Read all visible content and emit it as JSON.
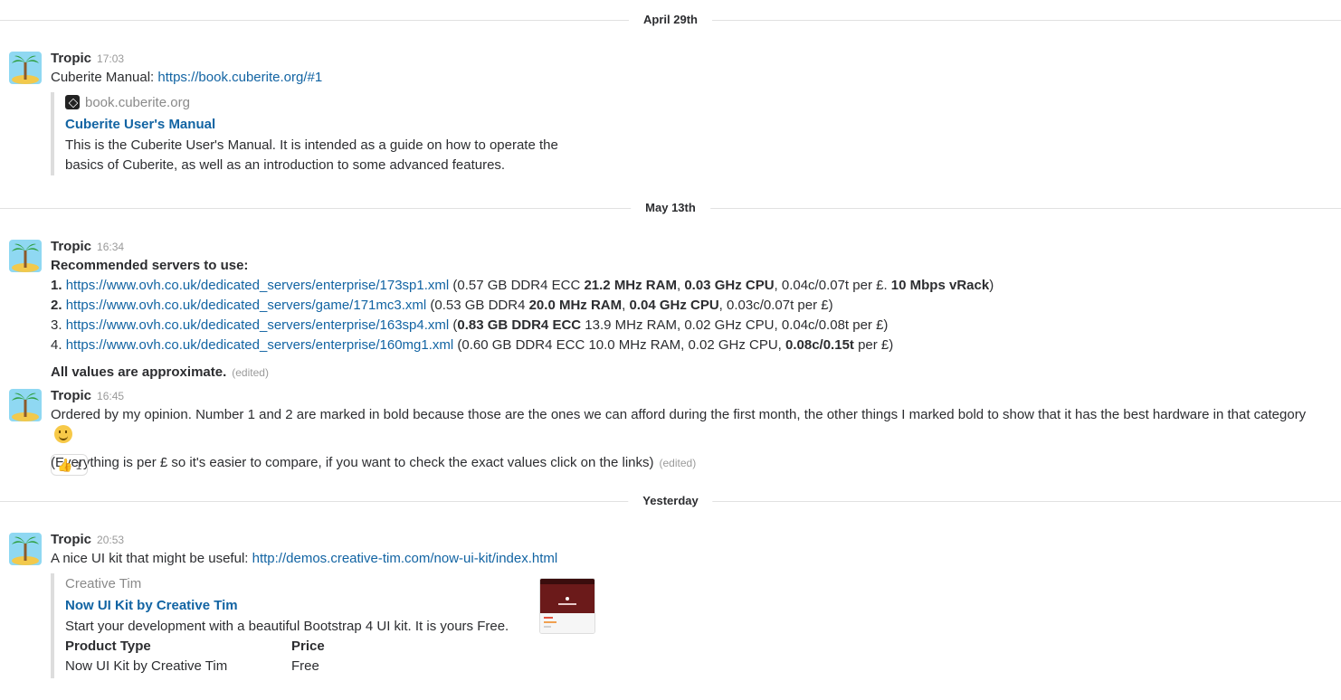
{
  "dividers": [
    "April 29th",
    "May 13th",
    "Yesterday"
  ],
  "messages": {
    "m1": {
      "sender": "Tropic",
      "time": "17:03",
      "prefix": "Cuberite Manual: ",
      "link": "https://book.cuberite.org/#1",
      "attachment": {
        "service": "book.cuberite.org",
        "title": "Cuberite User's Manual",
        "text1": "This is the Cuberite User's Manual. It is intended as a guide on how to operate the",
        "text2": "basics of Cuberite, as well as an introduction to some advanced features."
      }
    },
    "m2": {
      "sender": "Tropic",
      "time": "16:34",
      "heading": "Recommended servers to use:",
      "items": [
        {
          "num": "1.",
          "url": "https://www.ovh.co.uk/dedicated_servers/enterprise/173sp1.xml",
          "a": " (0.57 GB DDR4 ECC ",
          "b1": "21.2 MHz RAM",
          "c": ", ",
          "b2": "0.03 GHz CPU",
          "d": ", 0.04c/0.07t per £. ",
          "b3": "10 Mbps vRack",
          "e": ")"
        },
        {
          "num": "2.",
          "url": "https://www.ovh.co.uk/dedicated_servers/game/171mc3.xml",
          "a": " (0.53 GB DDR4 ",
          "b1": "20.0 MHz RAM",
          "c": ", ",
          "b2": "0.04 GHz CPU",
          "d": ", 0.03c/0.07t per £)"
        },
        {
          "num": "3.",
          "url": "https://www.ovh.co.uk/dedicated_servers/enterprise/163sp4.xml",
          "a": " (",
          "b1": "0.83 GB DDR4 ECC",
          "c": " 13.9 MHz RAM, 0.02 GHz CPU, 0.04c/0.08t per £)"
        },
        {
          "num": "4.",
          "url": "https://www.ovh.co.uk/dedicated_servers/enterprise/160mg1.xml",
          "a": " (0.60 GB DDR4 ECC 10.0 MHz RAM, 0.02 GHz CPU, ",
          "b1": "0.08c/0.15t",
          "c": " per £)"
        }
      ],
      "footer": "All values are approximate.",
      "edited": "(edited)"
    },
    "m3": {
      "sender": "Tropic",
      "time": "16:45",
      "text1": "Ordered by my opinion. Number 1 and 2 are marked in bold because those are the ones we can afford during the first month, the other things I marked bold to show that it has the best hardware in that category",
      "emoji": "slightly-smiling-face-icon",
      "text2": "(Everything is per £ so it's easier to compare, if you want to check the exact values click on the links)",
      "edited": "(edited)",
      "reaction": {
        "icon": "thumbs-up-icon",
        "count": "1"
      }
    },
    "m4": {
      "sender": "Tropic",
      "time": "20:53",
      "prefix": "A nice UI kit that might be useful: ",
      "link": "http://demos.creative-tim.com/now-ui-kit/index.html",
      "attachment": {
        "service": "Creative Tim",
        "title": "Now UI Kit by Creative Tim",
        "text": "Start your development with a beautiful Bootstrap 4 UI kit. It is yours Free.",
        "fields": [
          {
            "label": "Product Type",
            "value": "Now UI Kit by Creative Tim"
          },
          {
            "label": "Price",
            "value": "Free"
          }
        ]
      }
    }
  },
  "colors": {
    "link": "#1264a3",
    "divider": "#e1e1e1",
    "attachment_bar": "#dddddd"
  }
}
